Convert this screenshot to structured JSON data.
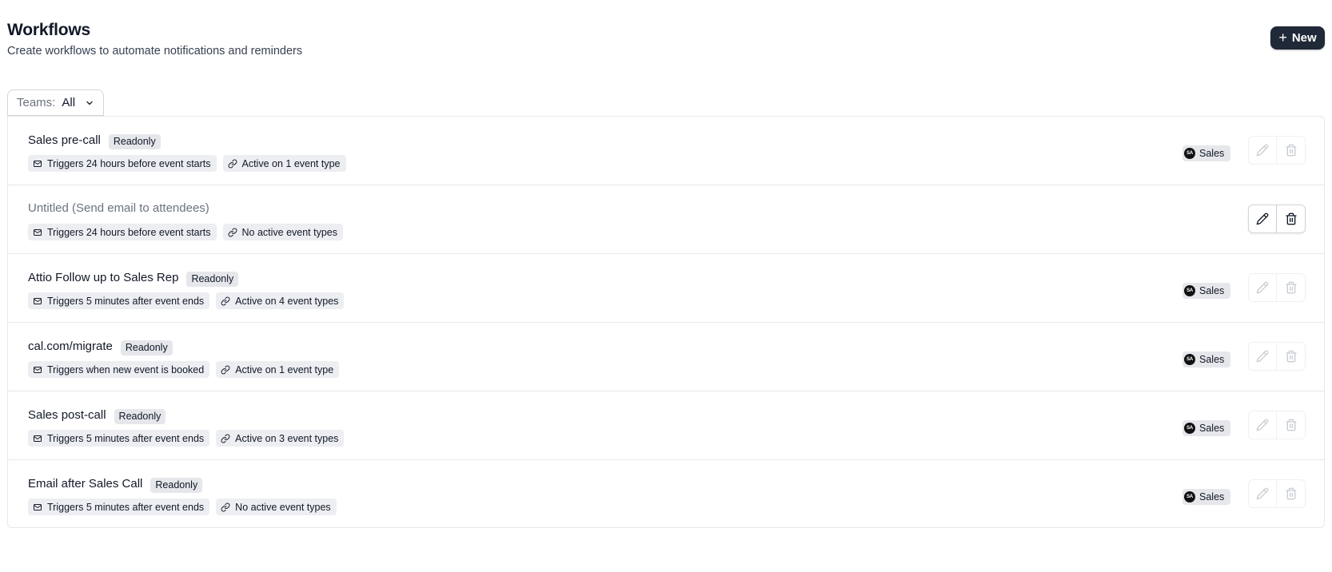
{
  "header": {
    "title": "Workflows",
    "subtitle": "Create workflows to automate notifications and reminders",
    "new_button_label": "New"
  },
  "filter": {
    "label": "Teams:",
    "value": "All"
  },
  "workflows": [
    {
      "name": "Sales pre-call",
      "badge": "Readonly",
      "trigger": "Triggers 24 hours before event starts",
      "active": "Active on 1 event type",
      "team": "Sales",
      "team_initials": "SA",
      "readonly": true
    },
    {
      "name": "Untitled (Send email to attendees)",
      "badge": "",
      "trigger": "Triggers 24 hours before event starts",
      "active": "No active event types",
      "team": "",
      "team_initials": "",
      "readonly": false
    },
    {
      "name": "Attio Follow up to Sales Rep",
      "badge": "Readonly",
      "trigger": "Triggers 5 minutes after event ends",
      "active": "Active on 4 event types",
      "team": "Sales",
      "team_initials": "SA",
      "readonly": true
    },
    {
      "name": "cal.com/migrate",
      "badge": "Readonly",
      "trigger": "Triggers when new event is booked",
      "active": "Active on 1 event type",
      "team": "Sales",
      "team_initials": "SA",
      "readonly": true
    },
    {
      "name": "Sales post-call",
      "badge": "Readonly",
      "trigger": "Triggers 5 minutes after event ends",
      "active": "Active on 3 event types",
      "team": "Sales",
      "team_initials": "SA",
      "readonly": true
    },
    {
      "name": "Email after Sales Call",
      "badge": "Readonly",
      "trigger": "Triggers 5 minutes after event ends",
      "active": "No active event types",
      "team": "Sales",
      "team_initials": "SA",
      "readonly": true
    }
  ],
  "icons": {
    "trigger": "mail-icon",
    "active": "link-icon",
    "edit": "pencil-icon",
    "delete": "trash-icon",
    "new": "plus-icon",
    "filter": "chevron-down-icon"
  },
  "colors": {
    "primary_button": "#1f2937",
    "badge_bg": "#e5e7eb",
    "border": "#e5e7eb"
  }
}
